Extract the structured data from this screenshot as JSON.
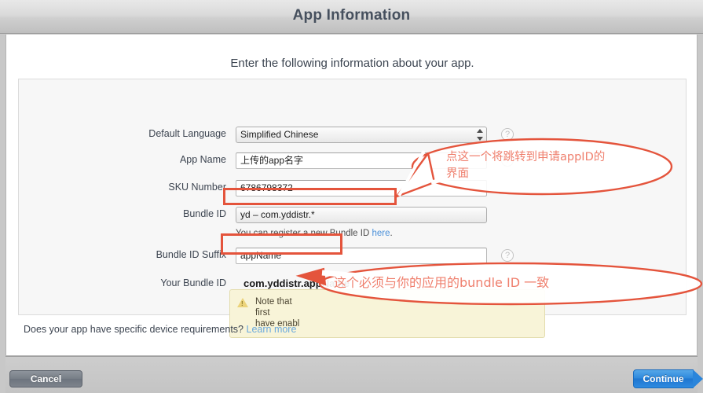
{
  "window": {
    "title": "App Information"
  },
  "sheet": {
    "headline": "Enter the following information about your app.",
    "device_question": "Does your app have specific device requirements?",
    "device_link": "Learn more"
  },
  "form": {
    "fields": [
      {
        "label": "Default Language",
        "value": "Simplified Chinese",
        "type": "select",
        "help": "?"
      },
      {
        "label": "App Name",
        "value": "上传的app名字",
        "type": "text",
        "help": "?"
      },
      {
        "label": "SKU Number",
        "value": "6786798372",
        "type": "text",
        "help": "?"
      },
      {
        "label": "Bundle ID",
        "value": "yd – com.yddistr.*",
        "type": "select-plain",
        "help": "?"
      },
      {
        "label": "Bundle ID Suffix",
        "value": "appName",
        "type": "text",
        "help": "?"
      },
      {
        "label": "Your Bundle ID",
        "value": "com.yddistr.appName",
        "type": "static",
        "help": ""
      }
    ],
    "bundle_hint_prefix": "You can register a new Bundle ID ",
    "bundle_hint_link": "here",
    "bundle_hint_suffix": ".",
    "note": {
      "line1": "Note that",
      "line2": "first",
      "line3": "have enabl"
    }
  },
  "toolbar": {
    "cancel_label": "Cancel",
    "continue_label": "Continue"
  },
  "annotations": {
    "callout1": "点这一个将跳转到申请appID的\n界面",
    "callout2": "这个必须与你的应用的bundle ID 一致",
    "accent_color": "#e4543c",
    "text_color": "#ef7f6d"
  }
}
